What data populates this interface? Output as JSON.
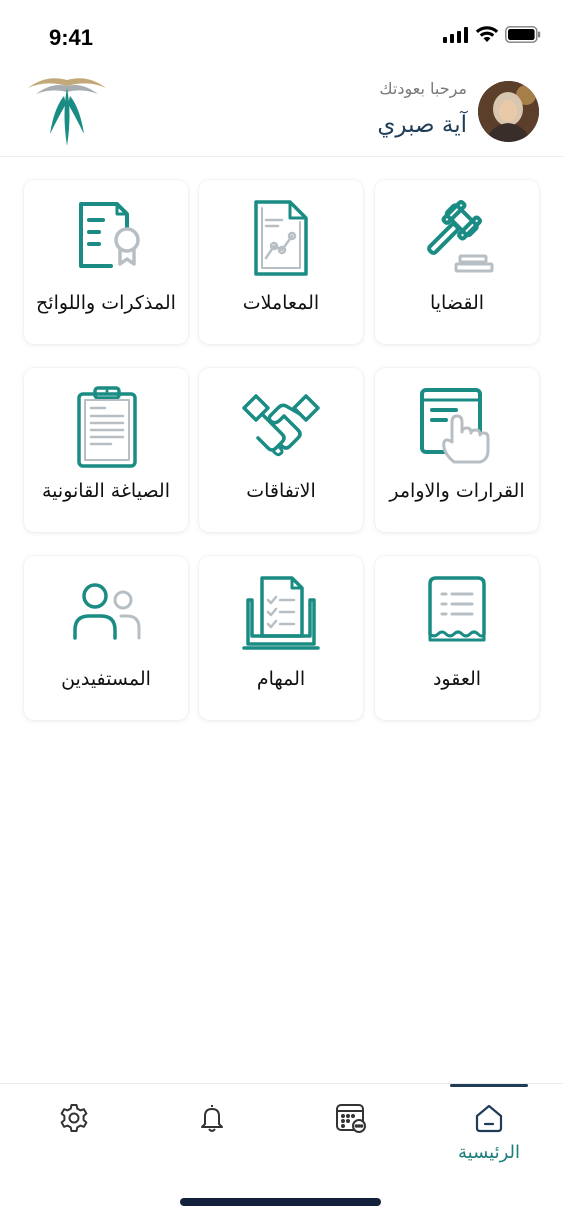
{
  "status_bar": {
    "time": "9:41"
  },
  "header": {
    "greeting": "مرحبا بعودتك",
    "user_name": "آية صبري"
  },
  "colors": {
    "accent": "#1A8C84",
    "navy": "#1F3D57",
    "gray": "#B8BFC4"
  },
  "tiles": [
    {
      "label": "القضايا",
      "icon": "gavel-icon"
    },
    {
      "label": "المعاملات",
      "icon": "document-chart-icon"
    },
    {
      "label": "المذكرات واللوائح",
      "icon": "document-certificate-icon"
    },
    {
      "label": "القرارات والاوامر",
      "icon": "document-touch-icon"
    },
    {
      "label": "الاتفاقات",
      "icon": "handshake-icon"
    },
    {
      "label": "الصياغة القانونية",
      "icon": "clipboard-icon"
    },
    {
      "label": "العقود",
      "icon": "contract-scroll-icon"
    },
    {
      "label": "المهام",
      "icon": "tasks-laptop-icon"
    },
    {
      "label": "المستفيدين",
      "icon": "users-icon"
    }
  ],
  "bottom_nav": {
    "home_label": "الرئيسية",
    "items": [
      "home-icon",
      "calendar-icon",
      "bell-icon",
      "settings-icon"
    ]
  }
}
